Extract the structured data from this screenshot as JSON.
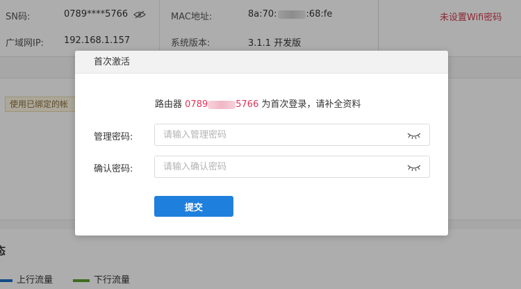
{
  "device_info": {
    "sn_label": "SN码:",
    "sn_value": "0789****5766",
    "mac_label": "MAC地址:",
    "mac_prefix": "8a:70:",
    "mac_suffix": ":68:fe",
    "wan_ip_label": "广域网IP:",
    "wan_ip_value": "192.168.1.157",
    "version_label": "系统版本:",
    "version_value": "3.1.1 开发版",
    "wifi_warning": "未设置Wifi密码"
  },
  "notice": {
    "text": "使用已绑定的帐"
  },
  "status": {
    "title": "态",
    "legend_upload": "上行流量",
    "legend_download": "下行流量",
    "upload_color": "#1a6fc4",
    "download_color": "#5aa02c"
  },
  "modal": {
    "title": "首次激活",
    "message_prefix": "路由器",
    "sn_start": "0789",
    "sn_end": "5766",
    "message_suffix": "为首次登录，请补全资料",
    "password_label": "管理密码:",
    "password_placeholder": "请输入管理密码",
    "confirm_label": "确认密码:",
    "confirm_placeholder": "请输入确认密码",
    "submit_label": "提交",
    "accent_color": "#1f7fdc",
    "highlight_color": "#e0325a"
  }
}
